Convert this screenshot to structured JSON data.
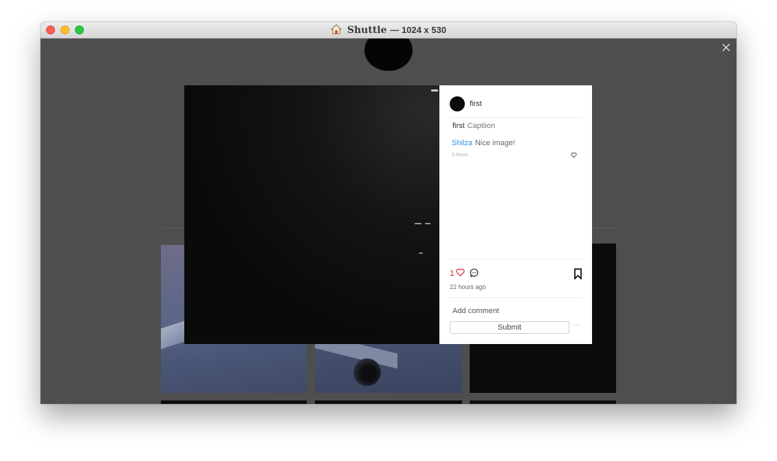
{
  "window": {
    "title": "Shuttle",
    "dimensions": "— 1024 x 530"
  },
  "post": {
    "username": "first",
    "caption_user": "first",
    "caption_text": "Captiion",
    "comments": [
      {
        "user": "Shilza",
        "text": "Nice image!",
        "time": "3 hours"
      }
    ],
    "likes": "1",
    "posted_ago": "22 hours ago",
    "comment_placeholder": "Add comment",
    "submit_label": "Submit",
    "more_label": "···"
  },
  "icons": {
    "home": "home-icon",
    "close": "close-icon",
    "heart": "heart-icon",
    "chat": "chat-icon",
    "bookmark": "bookmark-icon"
  },
  "colors": {
    "like_red": "#d9363e",
    "link_blue": "#2d8fe6",
    "overlay": "#4e4e4e"
  }
}
